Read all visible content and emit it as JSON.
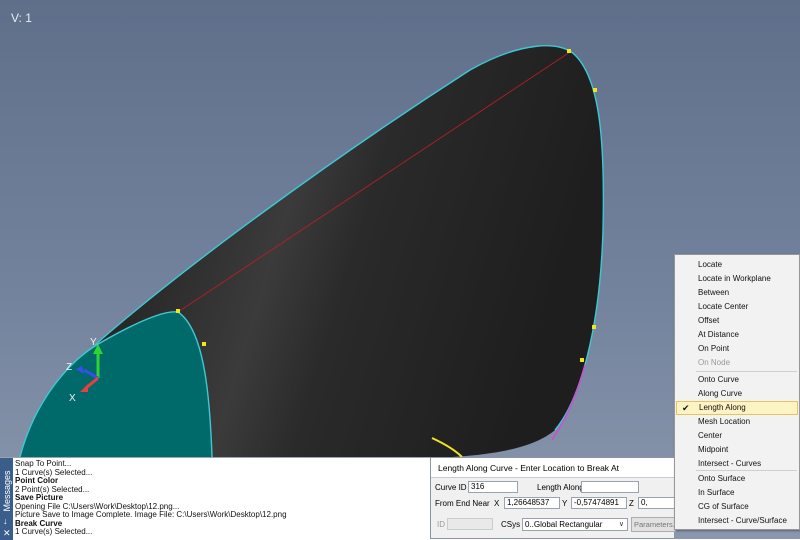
{
  "viewport": {
    "view_label": "V: 1"
  },
  "axis_triad": {
    "y": "Y",
    "z": "Z",
    "x": "X"
  },
  "messages": {
    "tab_label": "Messages",
    "lines": [
      {
        "text": "Snap To Point...",
        "bold": false
      },
      {
        "text": "1 Curve(s) Selected...",
        "bold": false
      },
      {
        "text": "Point Color",
        "bold": true
      },
      {
        "text": "2 Point(s) Selected...",
        "bold": false
      },
      {
        "text": "Save Picture",
        "bold": true
      },
      {
        "text": "Opening File C:\\Users\\Work\\Desktop\\12.png...",
        "bold": false
      },
      {
        "text": "Picture Save to Image Complete.  Image File: C:\\Users\\Work\\Desktop\\12.png",
        "bold": false
      },
      {
        "text": "Break Curve",
        "bold": true
      },
      {
        "text": "1 Curve(s) Selected...",
        "bold": false
      }
    ]
  },
  "dialog": {
    "title": "Length Along Curve - Enter Location to Break At",
    "curve_id_label": "Curve ID",
    "curve_id_value": "316",
    "length_along_label": "Length Along",
    "length_along_value": "",
    "from_end_near_label": "From End Near",
    "x_label": "X",
    "x_value": "1,26648537",
    "y_label": "Y",
    "y_value": "-0,57474891",
    "z_label": "Z",
    "z_value": "0,",
    "id_label": "ID",
    "id_value": "",
    "csys_label": "CSys",
    "csys_value": "0..Global Rectangular",
    "parameters_label": "Parameters..."
  },
  "context_menu": {
    "items": [
      {
        "label": "Locate",
        "enabled": true,
        "checked": false
      },
      {
        "label": "Locate in Workplane",
        "enabled": true,
        "checked": false
      },
      {
        "label": "Between",
        "enabled": true,
        "checked": false
      },
      {
        "label": "Locate Center",
        "enabled": true,
        "checked": false
      },
      {
        "label": "Offset",
        "enabled": true,
        "checked": false
      },
      {
        "label": "At Distance",
        "enabled": true,
        "checked": false
      },
      {
        "label": "On Point",
        "enabled": true,
        "checked": false
      },
      {
        "label": "On Node",
        "enabled": false,
        "checked": false
      },
      {
        "label": "Onto Curve",
        "enabled": true,
        "checked": false
      },
      {
        "label": "Along Curve",
        "enabled": true,
        "checked": false
      },
      {
        "label": "Length Along",
        "enabled": true,
        "checked": true
      },
      {
        "label": "Mesh Location",
        "enabled": true,
        "checked": false
      },
      {
        "label": "Center",
        "enabled": true,
        "checked": false
      },
      {
        "label": "Midpoint",
        "enabled": true,
        "checked": false
      },
      {
        "label": "Intersect - Curves",
        "enabled": true,
        "checked": false
      },
      {
        "label": "Onto Surface",
        "enabled": true,
        "checked": false
      },
      {
        "label": "In Surface",
        "enabled": true,
        "checked": false
      },
      {
        "label": "CG of Surface",
        "enabled": true,
        "checked": false
      },
      {
        "label": "Intersect - Curve/Surface",
        "enabled": true,
        "checked": false
      }
    ]
  },
  "colors": {
    "viewport_bg": "#6b7b96",
    "surface_dark": "#2c2c2c",
    "surface_teal": "#006a6a",
    "edge_cyan": "#3ec8d2",
    "point_yellow": "#f0e61e",
    "highlight": "#fdf3c3"
  }
}
